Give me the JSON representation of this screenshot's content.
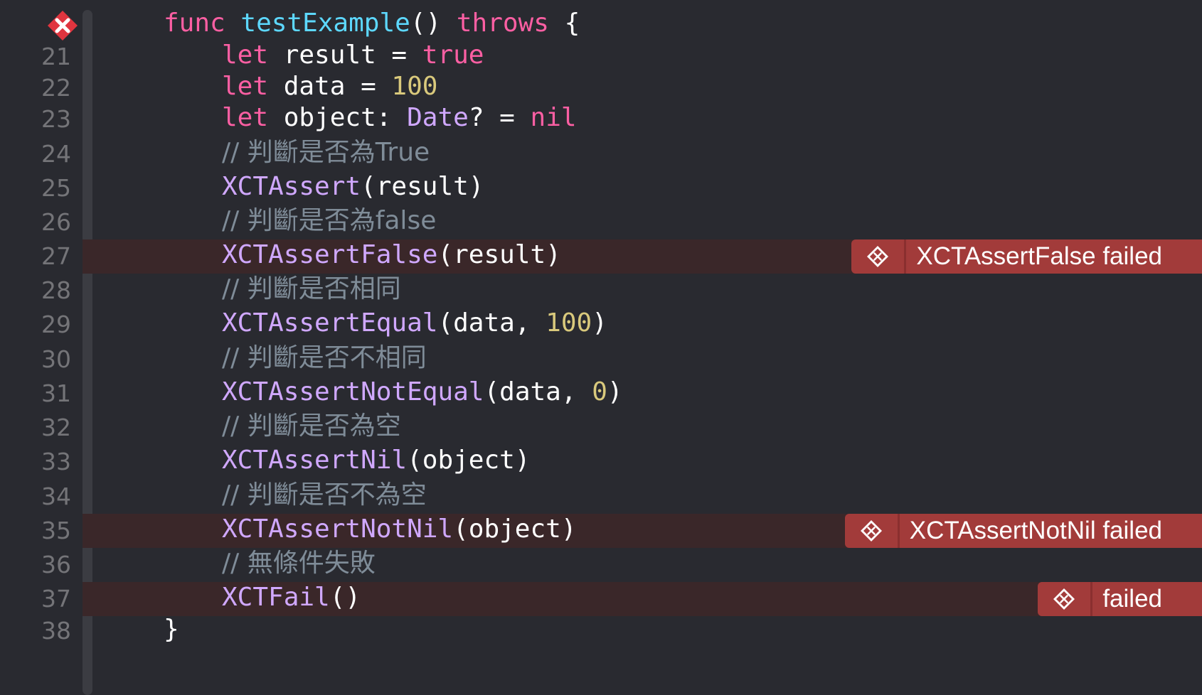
{
  "editor": {
    "signature": {
      "kw_func": "func",
      "name": "testExample",
      "parens": "()",
      "kw_throws": "throws",
      "brace": "{"
    },
    "line_numbers": [
      "21",
      "22",
      "23",
      "24",
      "25",
      "26",
      "27",
      "28",
      "29",
      "30",
      "31",
      "32",
      "33",
      "34",
      "35",
      "36",
      "37",
      "38"
    ],
    "lines": {
      "l21": {
        "kw": "let",
        "var": " result = ",
        "val": "true"
      },
      "l22": {
        "kw": "let",
        "var": " data = ",
        "val": "100"
      },
      "l23": {
        "kw": "let",
        "var": " object: ",
        "type": "Date",
        "rest": "? = ",
        "val": "nil"
      },
      "l24": {
        "comment": "// 判斷是否為True"
      },
      "l25": {
        "fn": "XCTAssert",
        "args": "(result)"
      },
      "l26": {
        "comment": "// 判斷是否為false"
      },
      "l27": {
        "fn": "XCTAssertFalse",
        "args": "(result)"
      },
      "l28": {
        "comment": "// 判斷是否相同"
      },
      "l29": {
        "fn": "XCTAssertEqual",
        "pre": "(data, ",
        "num": "100",
        "post": ")"
      },
      "l30": {
        "comment": "// 判斷是否不相同"
      },
      "l31": {
        "fn": "XCTAssertNotEqual",
        "pre": "(data, ",
        "num": "0",
        "post": ")"
      },
      "l32": {
        "comment": "// 判斷是否為空"
      },
      "l33": {
        "fn": "XCTAssertNil",
        "args": "(object)"
      },
      "l34": {
        "comment": "// 判斷是否不為空"
      },
      "l35": {
        "fn": "XCTAssertNotNil",
        "args": "(object)"
      },
      "l36": {
        "comment": "// 無條件失敗"
      },
      "l37": {
        "fn": "XCTFail",
        "args": "()"
      },
      "l38": {
        "close": "}"
      }
    },
    "errors": {
      "e27": "XCTAssertFalse failed",
      "e35": "XCTAssertNotNil failed",
      "e37": "failed"
    },
    "icons": {
      "gutter": "test-failed-icon",
      "badge": "error-icon"
    },
    "colors": {
      "background": "#292a30",
      "keyword": "#fc5fa3",
      "function": "#5dd8ff",
      "class": "#d0a8ff",
      "number": "#d9c97c",
      "comment": "#7f8c98",
      "error": "#a23b3a",
      "error_line": "#3a2729"
    }
  }
}
